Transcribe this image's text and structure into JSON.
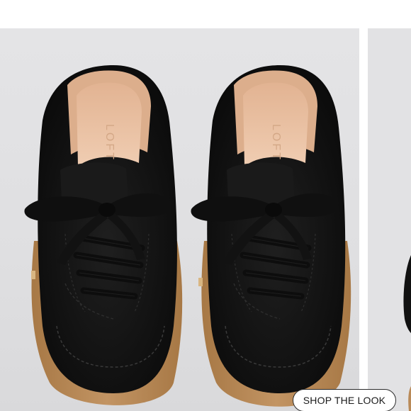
{
  "product_image": {
    "alt": "",
    "brand_imprint": "LOFT"
  },
  "cta": {
    "label": "SHOP THE LOOK"
  },
  "colors": {
    "background": "#e2e2e4",
    "suede": "#141414",
    "lining": "#e9c3a6",
    "sole": "#b98a58",
    "button_border": "#2b2b2b"
  }
}
